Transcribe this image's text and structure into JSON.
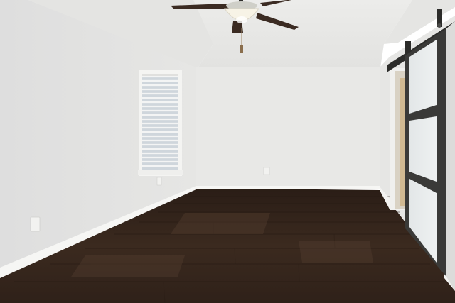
{
  "scene": {
    "colors": {
      "ceiling": "#e9e9e7",
      "ceiling_shade": "#dededc",
      "wall_left": "#e3e3e1",
      "wall_back": "#e8e8e6",
      "wall_right": "#e6e6e4",
      "baseboard": "#f6f6f4",
      "floor_dark": "#2f2119",
      "floor_mid": "#3d2b20",
      "floor_light": "#4a3527",
      "door_frame": "#3a3a38",
      "door_panel": "#e9ecec",
      "rail": "#2c2c2a",
      "fan_blade": "#3b2b22",
      "fan_light": "#f7f3e6",
      "window_glass": "#cfd6dc",
      "window_blinds": "#f3f4f4",
      "window_trim": "#f4f4f2"
    },
    "icons": [
      "ceiling-fan-icon",
      "barn-door-icon",
      "window-blinds-icon",
      "electrical-outlet-icon"
    ]
  }
}
